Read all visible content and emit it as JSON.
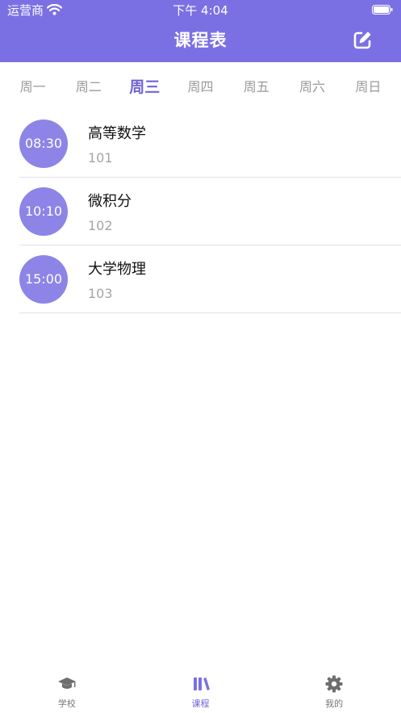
{
  "status_bar": {
    "carrier": "运营商",
    "time": "下午 4:04",
    "icons": [
      "wifi-icon",
      "battery-icon"
    ]
  },
  "header": {
    "title": "课程表",
    "action_icon": "edit-icon"
  },
  "days": {
    "items": [
      {
        "label": "周一",
        "active": false
      },
      {
        "label": "周二",
        "active": false
      },
      {
        "label": "周三",
        "active": true
      },
      {
        "label": "周四",
        "active": false
      },
      {
        "label": "周五",
        "active": false
      },
      {
        "label": "周六",
        "active": false
      },
      {
        "label": "周日",
        "active": false
      }
    ]
  },
  "courses": [
    {
      "time": "08:30",
      "name": "高等数学",
      "room": "101"
    },
    {
      "time": "10:10",
      "name": "微积分",
      "room": "102"
    },
    {
      "time": "15:00",
      "name": "大学物理",
      "room": "103"
    }
  ],
  "tabs": [
    {
      "label": "学校",
      "icon": "graduation-cap-icon",
      "active": false
    },
    {
      "label": "课程",
      "icon": "books-icon",
      "active": true
    },
    {
      "label": "我的",
      "icon": "gear-icon",
      "active": false
    }
  ],
  "colors": {
    "accent": "#7b70e3",
    "time_circle": "#8d84e8",
    "active_text": "#6f64d6",
    "inactive_text": "#9a9a9a"
  }
}
